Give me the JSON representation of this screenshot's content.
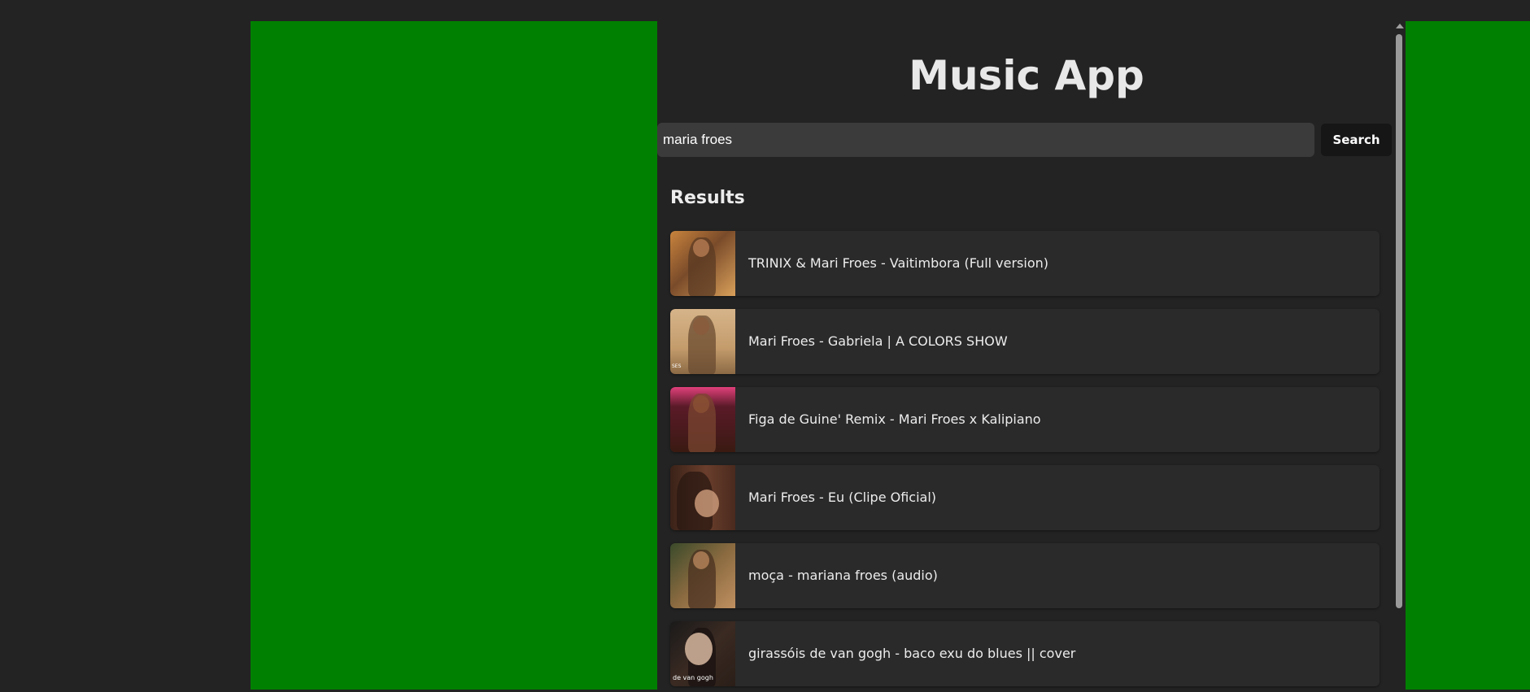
{
  "app": {
    "title": "Music App"
  },
  "search": {
    "value": "maria froes",
    "button_label": "Search"
  },
  "results": {
    "heading": "Results",
    "items": [
      {
        "title": "TRINIX & Mari Froes - Vaitimbora (Full version)"
      },
      {
        "title": "Mari Froes - Gabriela | A COLORS SHOW",
        "thumb_caption": "SES"
      },
      {
        "title": "Figa de Guine' Remix - Mari Froes x Kalipiano"
      },
      {
        "title": "Mari Froes - Eu (Clipe Oficial)"
      },
      {
        "title": "moça - mariana froes (audio)"
      },
      {
        "title": "girassóis de van gogh - baco exu do blues || cover",
        "thumb_caption": "de van gogh"
      }
    ]
  },
  "colors": {
    "side_panels": "#008000",
    "background": "#232323",
    "card": "#2a2a2a",
    "input": "#3b3b3b",
    "button": "#161616"
  }
}
